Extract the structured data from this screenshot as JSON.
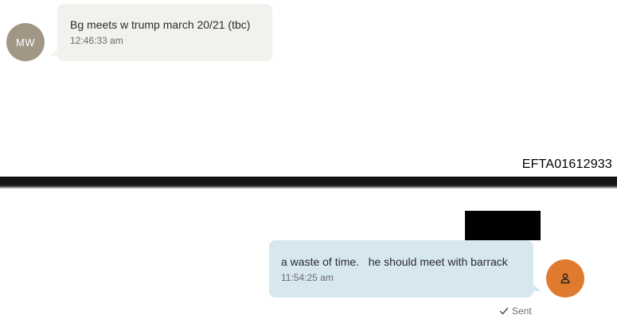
{
  "messages": [
    {
      "direction": "incoming",
      "sender_initials": "MW",
      "text": "Bg meets w trump march 20/21 (tbc)",
      "time": "12:46:33 am"
    },
    {
      "direction": "outgoing",
      "text": "a waste of time.   he should meet with barrack",
      "time": "11:54:25 am",
      "status": "Sent"
    }
  ],
  "document": {
    "id": "EFTA01612933"
  },
  "icons": {
    "outgoing_avatar": "person-icon",
    "status": "checkmark-icon"
  },
  "colors": {
    "incoming_avatar": "#a29787",
    "incoming_bubble": "#f2f1ed",
    "outgoing_bubble": "#d6e7f0",
    "outgoing_avatar": "#e07a2e",
    "redaction": "#000000"
  }
}
